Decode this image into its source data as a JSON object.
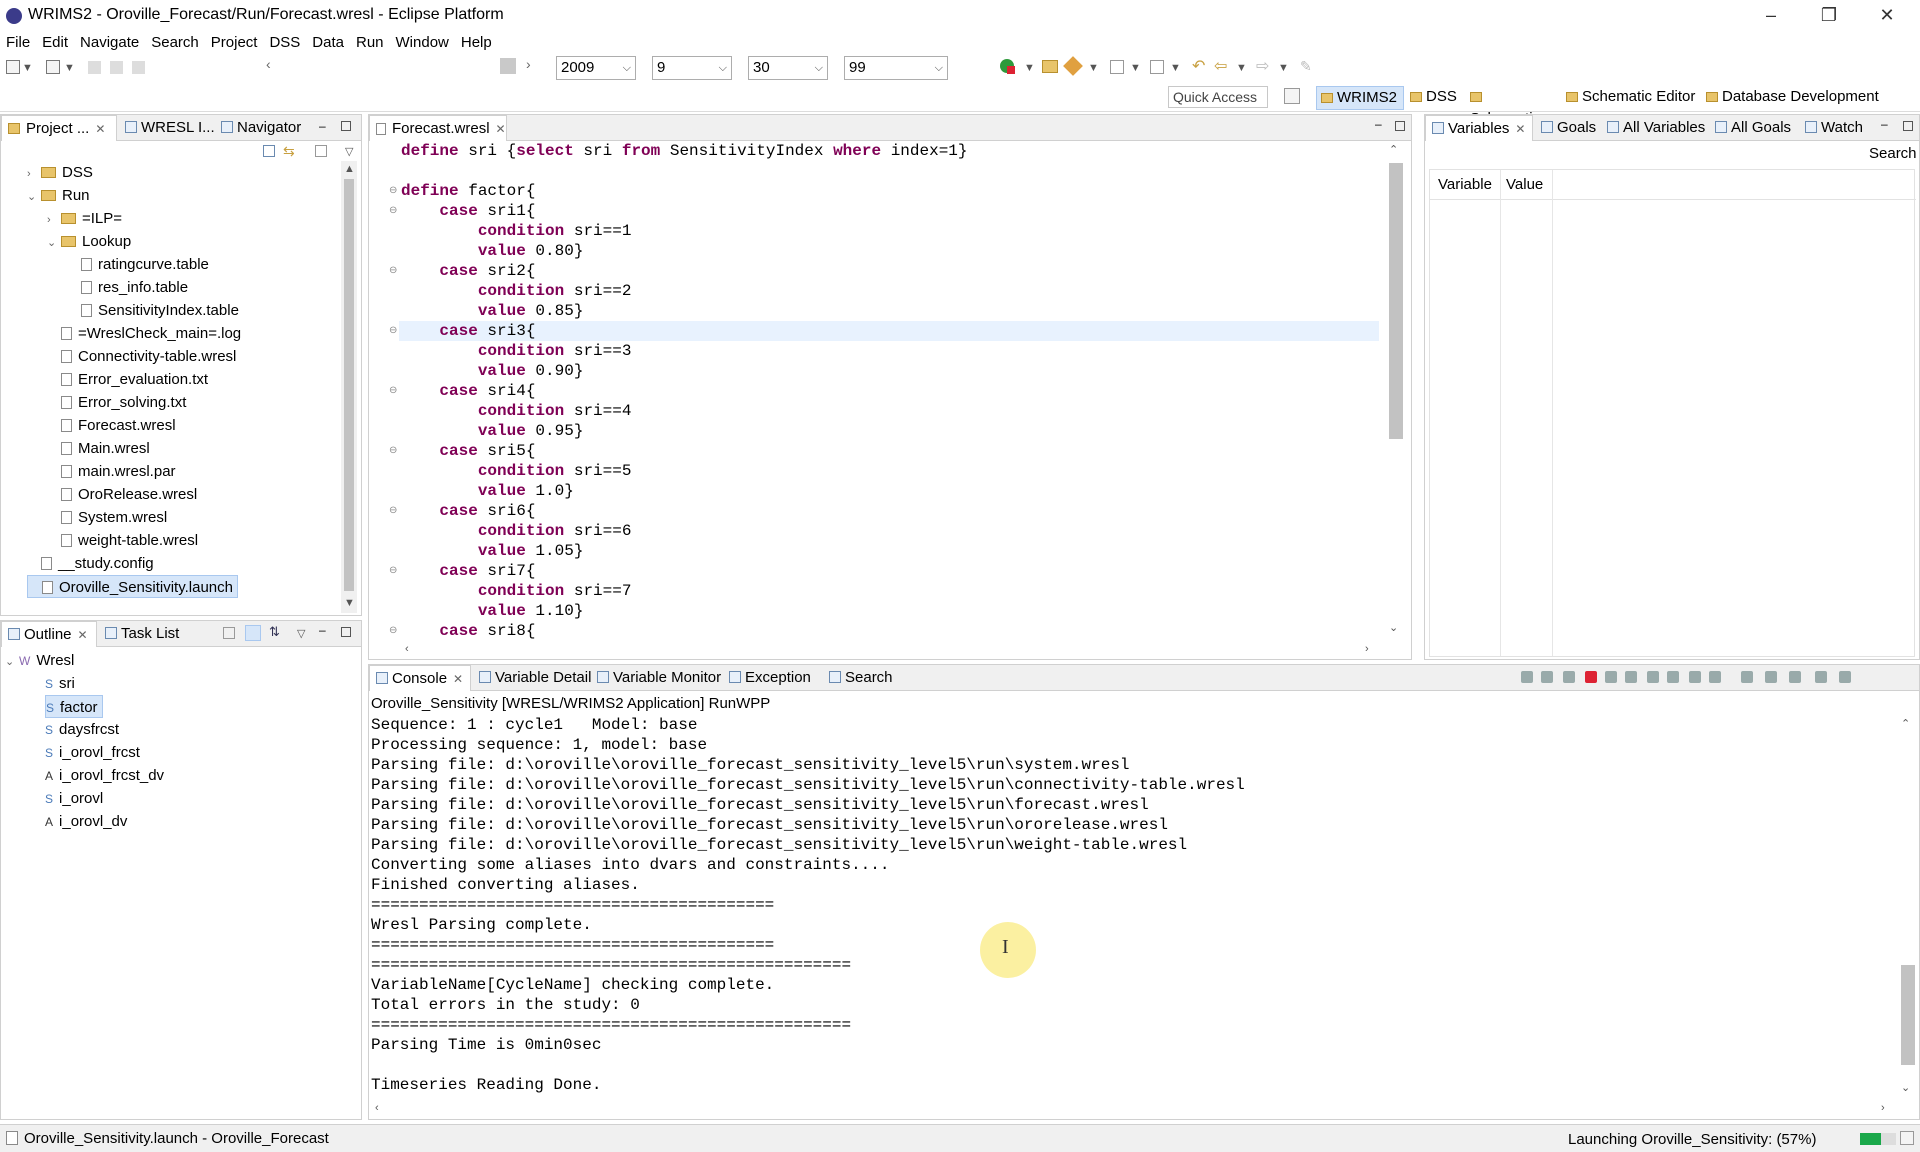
{
  "window": {
    "title": "WRIMS2 - Oroville_Forecast/Run/Forecast.wresl - Eclipse Platform"
  },
  "menu": [
    "File",
    "Edit",
    "Navigate",
    "Search",
    "Project",
    "DSS",
    "Data",
    "Run",
    "Window",
    "Help"
  ],
  "toolbar": {
    "year": "2009",
    "month": "9",
    "day": "30",
    "steps": "99"
  },
  "quick_access": "Quick Access",
  "perspectives": [
    "WRIMS2",
    "DSS",
    "Schematic",
    "Schematic Editor",
    "Database Development"
  ],
  "project_panel": {
    "tabs": [
      "Project ...",
      "WRESL I...",
      "Navigator"
    ],
    "tree": [
      {
        "label": "DSS",
        "depth": 1,
        "type": "folder",
        "twisty": "›"
      },
      {
        "label": "Run",
        "depth": 1,
        "type": "folder",
        "twisty": "⌄"
      },
      {
        "label": "=ILP=",
        "depth": 2,
        "type": "folder",
        "twisty": "›"
      },
      {
        "label": "Lookup",
        "depth": 2,
        "type": "folder",
        "twisty": "⌄"
      },
      {
        "label": "ratingcurve.table",
        "depth": 3,
        "type": "file"
      },
      {
        "label": "res_info.table",
        "depth": 3,
        "type": "file"
      },
      {
        "label": "SensitivityIndex.table",
        "depth": 3,
        "type": "file"
      },
      {
        "label": "=WreslCheck_main=.log",
        "depth": 2,
        "type": "file"
      },
      {
        "label": "Connectivity-table.wresl",
        "depth": 2,
        "type": "file"
      },
      {
        "label": "Error_evaluation.txt",
        "depth": 2,
        "type": "file"
      },
      {
        "label": "Error_solving.txt",
        "depth": 2,
        "type": "file"
      },
      {
        "label": "Forecast.wresl",
        "depth": 2,
        "type": "file"
      },
      {
        "label": "Main.wresl",
        "depth": 2,
        "type": "file"
      },
      {
        "label": "main.wresl.par",
        "depth": 2,
        "type": "file"
      },
      {
        "label": "OroRelease.wresl",
        "depth": 2,
        "type": "file"
      },
      {
        "label": "System.wresl",
        "depth": 2,
        "type": "file"
      },
      {
        "label": "weight-table.wresl",
        "depth": 2,
        "type": "file"
      },
      {
        "label": "__study.config",
        "depth": 1,
        "type": "file"
      },
      {
        "label": "Oroville_Sensitivity.launch",
        "depth": 1,
        "type": "file",
        "selected": true
      }
    ]
  },
  "outline_panel": {
    "tabs": [
      "Outline",
      "Task List"
    ],
    "root": "Wresl",
    "root_icon": "W",
    "items": [
      {
        "prefix": "S",
        "label": "sri"
      },
      {
        "prefix": "S",
        "label": "factor",
        "selected": true
      },
      {
        "prefix": "S",
        "label": "daysfrcst"
      },
      {
        "prefix": "S",
        "label": "i_orovl_frcst"
      },
      {
        "prefix": "A",
        "label": "i_orovl_frcst_dv"
      },
      {
        "prefix": "S",
        "label": "i_orovl"
      },
      {
        "prefix": "A",
        "label": "i_orovl_dv"
      }
    ]
  },
  "editor": {
    "tab": "Forecast.wresl",
    "lines": [
      [
        [
          "kw",
          "define"
        ],
        [
          "t",
          " sri {"
        ],
        [
          "kw",
          "select"
        ],
        [
          "t",
          " sri "
        ],
        [
          "kw",
          "from"
        ],
        [
          "t",
          " SensitivityIndex "
        ],
        [
          "kw",
          "where"
        ],
        [
          "t",
          " index=1}"
        ]
      ],
      [],
      [
        [
          "kw",
          "define"
        ],
        [
          "t",
          " factor{"
        ]
      ],
      [
        [
          "t",
          "    "
        ],
        [
          "kw",
          "case"
        ],
        [
          "t",
          " sri1{"
        ]
      ],
      [
        [
          "t",
          "        "
        ],
        [
          "kw",
          "condition"
        ],
        [
          "t",
          " sri==1"
        ]
      ],
      [
        [
          "t",
          "        "
        ],
        [
          "kw",
          "value"
        ],
        [
          "t",
          " 0.80}"
        ]
      ],
      [
        [
          "t",
          "    "
        ],
        [
          "kw",
          "case"
        ],
        [
          "t",
          " sri2{"
        ]
      ],
      [
        [
          "t",
          "        "
        ],
        [
          "kw",
          "condition"
        ],
        [
          "t",
          " sri==2"
        ]
      ],
      [
        [
          "t",
          "        "
        ],
        [
          "kw",
          "value"
        ],
        [
          "t",
          " 0.85}"
        ]
      ],
      [
        [
          "t",
          "    "
        ],
        [
          "kw",
          "case"
        ],
        [
          "t",
          " sri3{"
        ]
      ],
      [
        [
          "t",
          "        "
        ],
        [
          "kw",
          "condition"
        ],
        [
          "t",
          " sri==3"
        ]
      ],
      [
        [
          "t",
          "        "
        ],
        [
          "kw",
          "value"
        ],
        [
          "t",
          " 0.90}"
        ]
      ],
      [
        [
          "t",
          "    "
        ],
        [
          "kw",
          "case"
        ],
        [
          "t",
          " sri4{"
        ]
      ],
      [
        [
          "t",
          "        "
        ],
        [
          "kw",
          "condition"
        ],
        [
          "t",
          " sri==4"
        ]
      ],
      [
        [
          "t",
          "        "
        ],
        [
          "kw",
          "value"
        ],
        [
          "t",
          " 0.95}"
        ]
      ],
      [
        [
          "t",
          "    "
        ],
        [
          "kw",
          "case"
        ],
        [
          "t",
          " sri5{"
        ]
      ],
      [
        [
          "t",
          "        "
        ],
        [
          "kw",
          "condition"
        ],
        [
          "t",
          " sri==5"
        ]
      ],
      [
        [
          "t",
          "        "
        ],
        [
          "kw",
          "value"
        ],
        [
          "t",
          " 1.0}"
        ]
      ],
      [
        [
          "t",
          "    "
        ],
        [
          "kw",
          "case"
        ],
        [
          "t",
          " sri6{"
        ]
      ],
      [
        [
          "t",
          "        "
        ],
        [
          "kw",
          "condition"
        ],
        [
          "t",
          " sri==6"
        ]
      ],
      [
        [
          "t",
          "        "
        ],
        [
          "kw",
          "value"
        ],
        [
          "t",
          " 1.05}"
        ]
      ],
      [
        [
          "t",
          "    "
        ],
        [
          "kw",
          "case"
        ],
        [
          "t",
          " sri7{"
        ]
      ],
      [
        [
          "t",
          "        "
        ],
        [
          "kw",
          "condition"
        ],
        [
          "t",
          " sri==7"
        ]
      ],
      [
        [
          "t",
          "        "
        ],
        [
          "kw",
          "value"
        ],
        [
          "t",
          " 1.10}"
        ]
      ],
      [
        [
          "t",
          "    "
        ],
        [
          "kw",
          "case"
        ],
        [
          "t",
          " sri8{"
        ]
      ]
    ],
    "highlight_line": 9,
    "fold_lines": [
      2,
      3,
      6,
      9,
      12,
      15,
      18,
      21,
      24
    ]
  },
  "variables_panel": {
    "tabs": [
      "Variables",
      "Goals",
      "All Variables",
      "All Goals",
      "Watch"
    ],
    "search": "Search",
    "columns": [
      "Variable",
      "Value"
    ]
  },
  "console_panel": {
    "tabs": [
      "Console",
      "Variable Detail",
      "Variable Monitor",
      "Exception",
      "Search"
    ],
    "header": "Oroville_Sensitivity [WRESL/WRIMS2 Application] RunWPP",
    "lines": [
      "Sequence: 1 : cycle1   Model: base",
      "Processing sequence: 1, model: base",
      "Parsing file: d:\\oroville\\oroville_forecast_sensitivity_level5\\run\\system.wresl",
      "Parsing file: d:\\oroville\\oroville_forecast_sensitivity_level5\\run\\connectivity-table.wresl",
      "Parsing file: d:\\oroville\\oroville_forecast_sensitivity_level5\\run\\forecast.wresl",
      "Parsing file: d:\\oroville\\oroville_forecast_sensitivity_level5\\run\\ororelease.wresl",
      "Parsing file: d:\\oroville\\oroville_forecast_sensitivity_level5\\run\\weight-table.wresl",
      "Converting some aliases into dvars and constraints....",
      "Finished converting aliases.",
      "==========================================",
      "Wresl Parsing complete.",
      "==========================================",
      "==================================================",
      "VariableName[CycleName] checking complete.",
      "Total errors in the study: 0",
      "==================================================",
      "Parsing Time is 0min0sec",
      "",
      "Timeseries Reading Done."
    ]
  },
  "status": {
    "left": "Oroville_Sensitivity.launch - Oroville_Forecast",
    "right": "Launching Oroville_Sensitivity: (57%)",
    "progress": 0.57
  }
}
